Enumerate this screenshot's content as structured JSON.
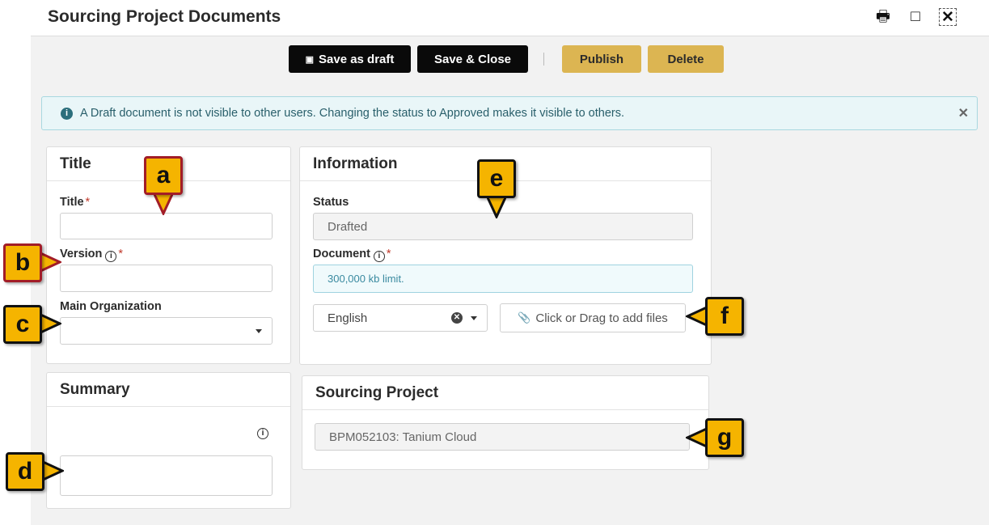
{
  "window": {
    "title": "Sourcing Project Documents"
  },
  "icons": {
    "print": "print-icon",
    "maximize": "maximize-icon",
    "close": "close-icon"
  },
  "toolbar": {
    "save_draft_label": "Save as draft",
    "save_close_label": "Save & Close",
    "publish_label": "Publish",
    "delete_label": "Delete"
  },
  "alert": {
    "message": "A Draft document is not visible to other users. Changing the status to Approved makes it visible to others."
  },
  "title_panel": {
    "header": "Title",
    "title_label": "Title",
    "title_value": "",
    "version_label": "Version",
    "version_value": "",
    "org_label": "Main Organization",
    "org_value": ""
  },
  "summary_panel": {
    "header": "Summary",
    "value": ""
  },
  "info_panel": {
    "header": "Information",
    "status_label": "Status",
    "status_value": "Drafted",
    "document_label": "Document",
    "document_placeholder": "300,000 kb limit.",
    "language_value": "English",
    "file_button_label": "Click or Drag to add files"
  },
  "sourcing_panel": {
    "header": "Sourcing Project",
    "value": "BPM052103: Tanium Cloud"
  },
  "callouts": {
    "a": "a",
    "b": "b",
    "c": "c",
    "d": "d",
    "e": "e",
    "f": "f",
    "g": "g"
  },
  "colors": {
    "accent_gold": "#dcb552",
    "callout_fill": "#f5b400",
    "alert_bg": "#e9f6f8"
  }
}
